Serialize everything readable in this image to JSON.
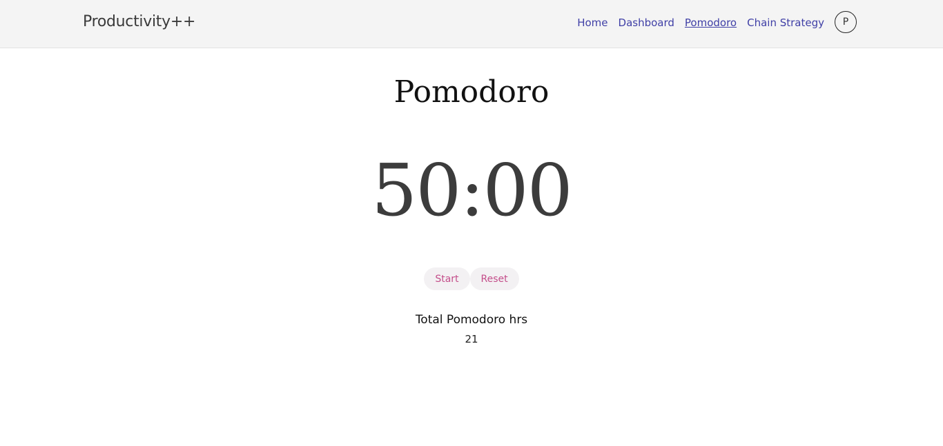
{
  "brand": "Productivity++",
  "nav": {
    "items": [
      {
        "label": "Home"
      },
      {
        "label": "Dashboard"
      },
      {
        "label": "Pomodoro",
        "active": true
      },
      {
        "label": "Chain Strategy"
      }
    ],
    "avatar_initial": "P"
  },
  "main": {
    "title": "Pomodoro",
    "timer": "50:00",
    "controls": {
      "start_label": "Start",
      "reset_label": "Reset"
    },
    "stats": {
      "label": "Total Pomodoro hrs",
      "value": "21"
    }
  },
  "colors": {
    "nav_link": "#3f3fa6",
    "button_text": "#c44d8a",
    "button_bg": "#f3f1f3",
    "navbar_bg": "#f4f4f4"
  }
}
